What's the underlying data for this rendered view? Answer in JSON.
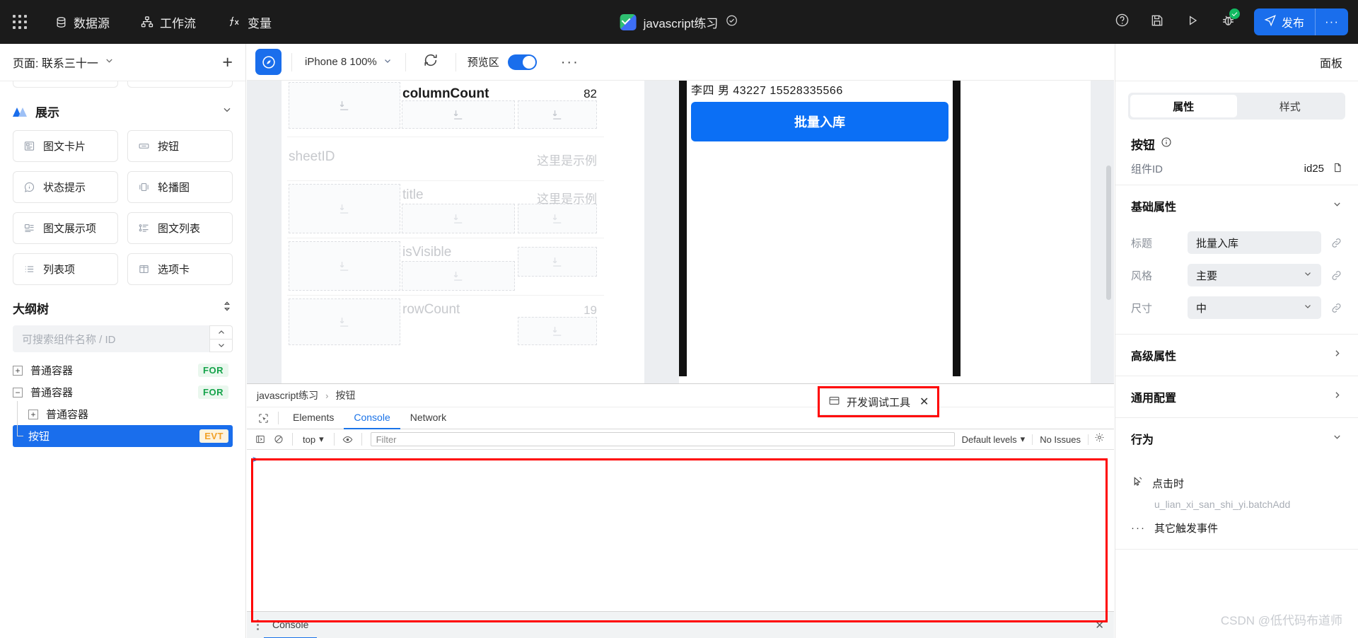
{
  "topbar": {
    "menus": [
      {
        "label": "数据源",
        "icon": "database-icon"
      },
      {
        "label": "工作流",
        "icon": "workflow-icon"
      },
      {
        "label": "变量",
        "icon": "fx-icon"
      }
    ],
    "project_title": "javascript练习",
    "publish_label": "发布",
    "more_label": "···",
    "icons": [
      "help-icon",
      "save-icon",
      "run-icon",
      "debug-icon"
    ],
    "accent": "#1a6eec"
  },
  "left": {
    "page_label": "页面: 联系三十一",
    "add_label": "+",
    "section": {
      "title": "展示"
    },
    "components": [
      {
        "label": "图文卡片",
        "icon": "image-text-card-icon"
      },
      {
        "label": "按钮",
        "icon": "button-icon"
      },
      {
        "label": "状态提示",
        "icon": "status-tip-icon"
      },
      {
        "label": "轮播图",
        "icon": "carousel-icon"
      },
      {
        "label": "图文展示项",
        "icon": "image-text-item-icon"
      },
      {
        "label": "图文列表",
        "icon": "image-text-list-icon"
      },
      {
        "label": "列表项",
        "icon": "list-item-icon"
      },
      {
        "label": "选项卡",
        "icon": "tabs-icon"
      }
    ],
    "outline": {
      "title": "大纲树",
      "search_placeholder": "可搜索组件名称 / ID",
      "nodes": [
        {
          "label": "普通容器",
          "toggle": "+",
          "tag": "FOR",
          "depth": 0,
          "selected": false
        },
        {
          "label": "普通容器",
          "toggle": "−",
          "tag": "FOR",
          "depth": 0,
          "selected": false
        },
        {
          "label": "普通容器",
          "toggle": "+",
          "tag": "",
          "depth": 1,
          "selected": false
        },
        {
          "label": "按钮",
          "toggle": "",
          "tag": "EVT",
          "depth": 1,
          "selected": true
        }
      ]
    }
  },
  "canvas": {
    "device_label": "iPhone 8 100%",
    "preview_label": "预览区",
    "preview_on": true,
    "more_label": "···",
    "editor_rows": [
      {
        "label": "columnCount",
        "value": "82",
        "highlight": true
      },
      {
        "label": "sheetID",
        "value": "这里是示例",
        "highlight": false
      },
      {
        "label": "title",
        "value": "这里是示例",
        "highlight": false
      },
      {
        "label": "isVisible",
        "value": "",
        "highlight": false
      },
      {
        "label": "rowCount",
        "value": "19",
        "highlight": false
      }
    ],
    "phone": {
      "record_text": "李四 男 43227 15528335566",
      "button_label": "批量入库"
    }
  },
  "devtools": {
    "pill_label": "开发调试工具",
    "pill_icon": "devtools-panel-icon",
    "breadcrumb": [
      "javascript练习",
      "按钮"
    ],
    "tabs": [
      {
        "label": "Elements",
        "active": false
      },
      {
        "label": "Console",
        "active": true
      },
      {
        "label": "Network",
        "active": false
      }
    ],
    "filterbar": {
      "context": "top",
      "filter_placeholder": "Filter",
      "levels": "Default levels",
      "issues": "No Issues"
    },
    "console_prompt": ">",
    "drawer_tab": "Console"
  },
  "right": {
    "panel_label": "面板",
    "tabs": [
      {
        "label": "属性",
        "active": true
      },
      {
        "label": "样式",
        "active": false
      }
    ],
    "component_name": "按钮",
    "component_id_label": "组件ID",
    "component_id_value": "id25",
    "sections": {
      "basic": "基础属性",
      "advanced": "高级属性",
      "common": "通用配置",
      "behavior": "行为"
    },
    "fields": [
      {
        "label": "标题",
        "value": "批量入库",
        "type": "input"
      },
      {
        "label": "风格",
        "value": "主要",
        "type": "select"
      },
      {
        "label": "尺寸",
        "value": "中",
        "type": "select"
      }
    ],
    "behavior": {
      "trigger_label": "点击时",
      "trigger_value": "u_lian_xi_san_shi_yi.batchAdd",
      "other_label": "其它触发事件"
    }
  },
  "watermark": "CSDN @低代码布道师"
}
